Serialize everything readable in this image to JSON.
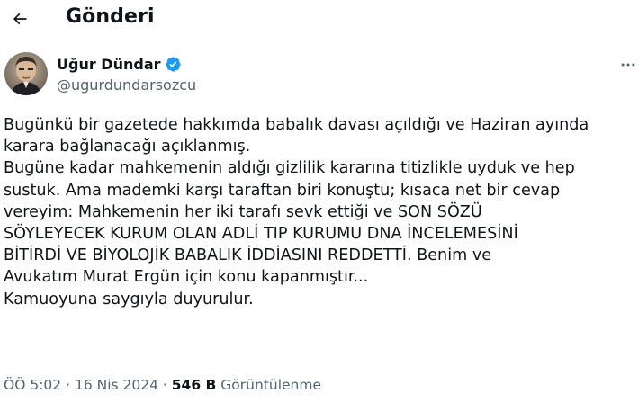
{
  "header": {
    "title": "Gönderi",
    "back_icon": "arrow-left-icon"
  },
  "author": {
    "display_name": "Uğur Dündar",
    "handle": "@ugurdundarsozcu",
    "verified_icon": "verified-badge-icon",
    "verified_color": "#1d9bf0",
    "more_icon": "more-horizontal-icon"
  },
  "tweet": {
    "lines": [
      "Bugünkü bir gazetede hakkımda babalık davası açıldığı ve Haziran ayında",
      "karara bağlanacağı açıklanmış.",
      "Bugüne kadar mahkemenin aldığı gizlilik kararına titizlikle uyduk ve hep",
      "sustuk. Ama mademki karşı taraftan biri konuştu; kısaca net bir cevap",
      "vereyim: Mahkemenin her iki tarafı sevk ettiği ve SON SÖZÜ",
      "SÖYLEYECEK KURUM OLAN ADLİ TIP KURUMU DNA İNCELEMESİNİ",
      "BİTİRDİ VE BİYOLOJİK BABALIK İDDİASINI REDDETTİ. Benim ve",
      "Avukatım Murat Ergün için konu kapanmıştır...",
      "Kamuoyuna saygıyla duyurulur."
    ]
  },
  "meta": {
    "time": "ÖÖ 5:02",
    "separator": "·",
    "date": "16 Nis 2024",
    "views_count": "546 B",
    "views_label": "Görüntülenme"
  },
  "colors": {
    "text_primary": "#0f1419",
    "text_secondary": "#536471",
    "accent": "#1d9bf0"
  }
}
